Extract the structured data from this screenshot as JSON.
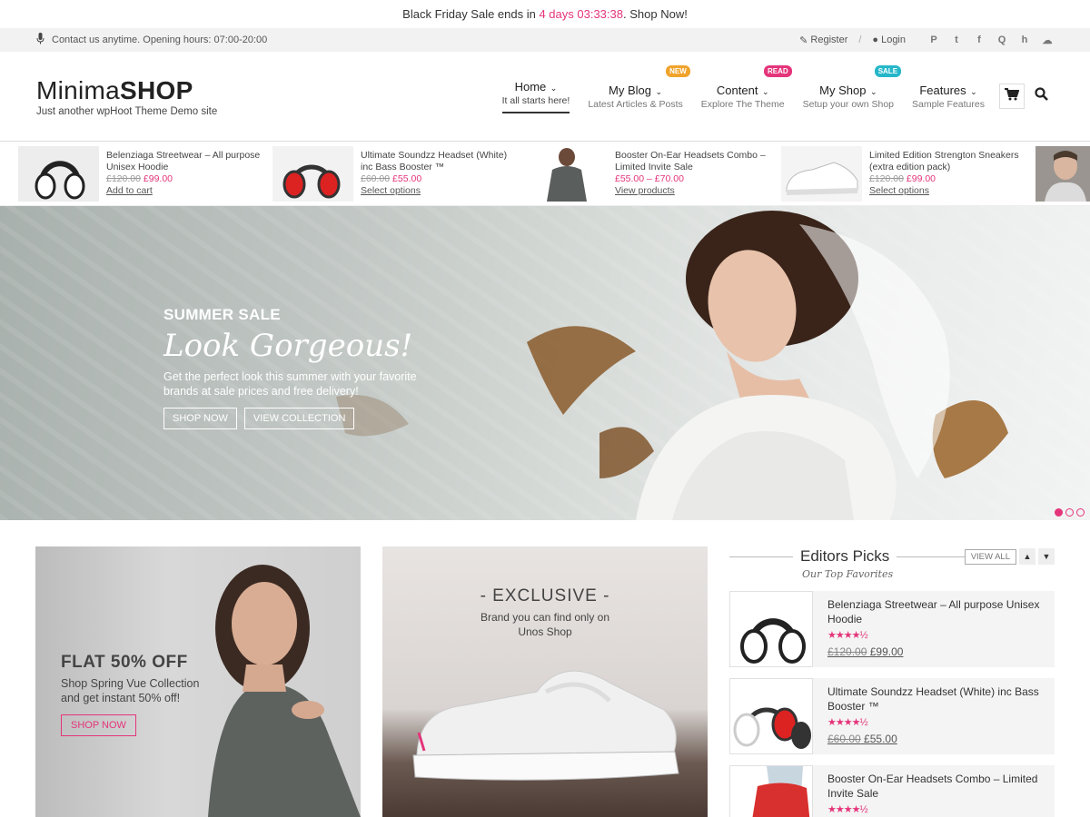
{
  "announce": {
    "prefix": "Black Friday Sale ends in ",
    "countdown": "4 days 03:33:38",
    "suffix": ". Shop Now!"
  },
  "topbar": {
    "contact": "Contact us anytime. Opening hours: 07:00-20:00",
    "register": "Register",
    "login": "Login",
    "social_icons": [
      "pinterest-icon",
      "twitter-icon",
      "facebook-icon",
      "quora-icon",
      "houzz-icon",
      "soundcloud-icon"
    ]
  },
  "header": {
    "logo_light": "Minima",
    "logo_bold": "SHOP",
    "tagline": "Just another wpHoot Theme Demo site",
    "nav": [
      {
        "label": "Home",
        "sub": "It all starts here!",
        "badge": "",
        "badge_color": ""
      },
      {
        "label": "My Blog",
        "sub": "Latest Articles & Posts",
        "badge": "NEW",
        "badge_color": "#f0a32b"
      },
      {
        "label": "Content",
        "sub": "Explore The Theme",
        "badge": "READ",
        "badge_color": "#e4347a"
      },
      {
        "label": "My Shop",
        "sub": "Setup your own Shop",
        "badge": "SALE",
        "badge_color": "#25b7c9"
      },
      {
        "label": "Features",
        "sub": "Sample Features",
        "badge": "",
        "badge_color": ""
      }
    ]
  },
  "ticker": [
    {
      "name": "Belenziaga Streetwear – All purpose Unisex Hoodie",
      "old": "£120.00",
      "new": "£99.00",
      "action": "Add to cart"
    },
    {
      "name": "Ultimate Soundzz Headset (White) inc Bass Booster ™",
      "old": "£60.00",
      "new": "£55.00",
      "action": "Select options"
    },
    {
      "name": "Booster On-Ear Headsets Combo – Limited Invite Sale",
      "old": "",
      "new": "£55.00 – £70.00",
      "action": "View products"
    },
    {
      "name": "Limited Edition Strengton Sneakers (extra edition pack)",
      "old": "£120.00",
      "new": "£99.00",
      "action": "Select options"
    }
  ],
  "hero": {
    "kicker": "SUMMER SALE",
    "title": "Look Gorgeous!",
    "desc": "Get the perfect look this summer with your favorite brands at sale prices and free delivery!",
    "btn1": "SHOP NOW",
    "btn2": "VIEW COLLECTION",
    "slides": 3,
    "active_slide": 1
  },
  "promo1": {
    "title": "FLAT 50% OFF",
    "desc": "Shop Spring Vue Collection and get instant 50% off!",
    "btn": "SHOP NOW"
  },
  "promo2": {
    "title": "- EXCLUSIVE -",
    "desc": "Brand you can find only on Unos Shop"
  },
  "picks": {
    "title": "Editors Picks",
    "subtitle": "Our Top Favorites",
    "view_all": "VIEW ALL",
    "items": [
      {
        "name": "Belenziaga Streetwear – All purpose Unisex Hoodie",
        "rating": 4.5,
        "old": "£120.00",
        "new": "£99.00"
      },
      {
        "name": "Ultimate Soundzz Headset (White) inc Bass Booster ™",
        "rating": 4.5,
        "old": "£60.00",
        "new": "£55.00"
      },
      {
        "name": "Booster On-Ear Headsets Combo – Limited Invite Sale",
        "rating": 4.5,
        "old": "",
        "new": ""
      }
    ]
  },
  "colors": {
    "accent": "#e4347a"
  }
}
